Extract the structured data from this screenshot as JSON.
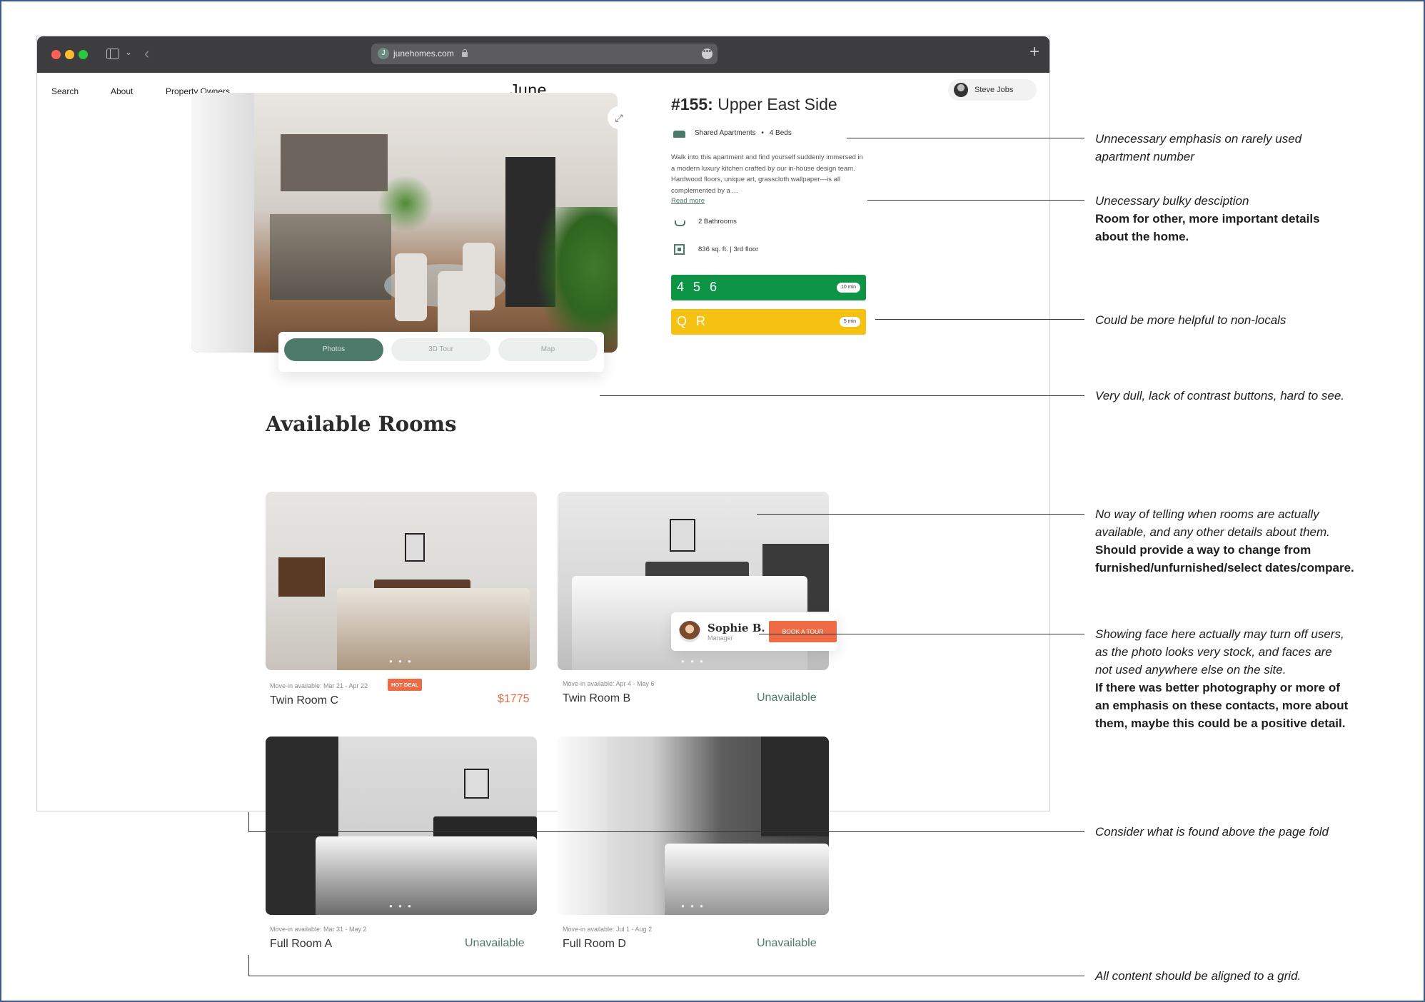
{
  "browser": {
    "url": "junehomes.com",
    "favicon_letter": "J",
    "more_glyph": "•••",
    "chevron_glyph": "⌄",
    "back_glyph": "‹",
    "newtab_glyph": "+"
  },
  "site": {
    "nav": [
      "Search",
      "About",
      "Property Owners"
    ],
    "logo": "June",
    "user_name": "Steve Jobs"
  },
  "listing": {
    "number": "#155:",
    "name": "Upper East Side",
    "type": "Shared Apartments",
    "separator": "•",
    "beds": "4 Beds",
    "description": "Walk into this apartment and find yourself suddenly immersed in a modern luxury kitchen crafted by our in-house design team. Hardwood floors, unique art, grasscloth wallpaper—is all complemented by a ...",
    "read_more": "Read more",
    "bathrooms": "2 Bathrooms",
    "area": "836 sq. ft.  |  3rd floor",
    "expand_glyph": "⤢",
    "transit": [
      {
        "lines": "4 5 6",
        "time": "10 min",
        "color": "#0e9445"
      },
      {
        "lines": "Q R",
        "time": "5 min",
        "color": "#f5c113"
      }
    ],
    "tabs": [
      "Photos",
      "3D Tour",
      "Map"
    ],
    "active_tab": "Photos"
  },
  "rooms": {
    "title": "Available Rooms",
    "dots": "● ● ●",
    "items": [
      {
        "move_in": "Move-in available: Mar 21 - Apr 22",
        "name": "Twin Room C",
        "status": "$1775",
        "badge": "HOT DEAL"
      },
      {
        "move_in": "Move-in available: Apr 4 - May 6",
        "name": "Twin Room B",
        "status": "Unavailable"
      },
      {
        "move_in": "Move-in available: Mar 31 - May 2",
        "name": "Full Room A",
        "status": "Unavailable"
      },
      {
        "move_in": "Move-in available: Jul 1 - Aug 2",
        "name": "Full Room D",
        "status": "Unavailable"
      }
    ],
    "manager": {
      "name": "Sophie B.",
      "role": "Manager",
      "button": "BOOK A TOUR"
    }
  },
  "annotations": [
    {
      "italic": [
        "Unnecessary emphasis on rarely used",
        "apartment number"
      ],
      "bold": []
    },
    {
      "italic": [
        "Unecessary bulky desciption"
      ],
      "bold": [
        "Room for other, more important details",
        "about the home."
      ]
    },
    {
      "italic": [
        "Could be more helpful to non-locals"
      ],
      "bold": []
    },
    {
      "italic": [
        "Very dull, lack of contrast buttons, hard to see."
      ],
      "bold": []
    },
    {
      "italic": [
        "No way of telling when rooms are actually",
        "available, and any other details about them."
      ],
      "bold": [
        "Should provide a way to change from",
        "furnished/unfurnished/select dates/compare."
      ]
    },
    {
      "italic": [
        "Showing face here actually may turn off users,",
        "as the photo looks very stock, and faces are",
        "not used anywhere else on the site."
      ],
      "bold": [
        "If there was better photography or more of",
        "an emphasis on these contacts, more about",
        "them, maybe this could be a positive detail."
      ]
    },
    {
      "italic": [
        "Consider what is found above the page fold"
      ],
      "bold": []
    },
    {
      "italic": [
        "All content should be aligned to a grid."
      ],
      "bold": []
    }
  ]
}
